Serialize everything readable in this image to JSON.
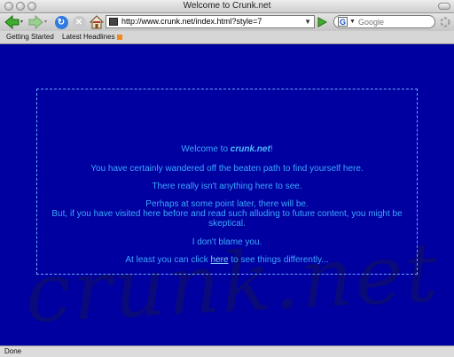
{
  "window": {
    "title": "Welcome to Crunk.net"
  },
  "toolbar": {
    "url": "http://www.crunk.net/index.html?style=7",
    "search_engine": "G",
    "search_placeholder": "Google",
    "icons": [
      "back-icon",
      "forward-icon",
      "reload-icon",
      "stop-icon",
      "home-icon",
      "go-icon",
      "throbber-icon"
    ]
  },
  "bookmarks": {
    "items": [
      {
        "label": "Getting Started"
      },
      {
        "label": "Latest Headlines"
      }
    ]
  },
  "page": {
    "welcome_prefix": "Welcome to ",
    "welcome_site": "crunk.net",
    "welcome_suffix": "!",
    "line1": "You have certainly wandered off the beaten path to find yourself here.",
    "line2": "There really isn't anything here to see.",
    "line3": "Perhaps at some point later, there will be.",
    "line4": "But, if you have visited here before and read such alluding to future content, you might be skeptical.",
    "line5": "I don't blame you.",
    "line6_prefix": "At least you can click ",
    "line6_link": "here",
    "line6_suffix": " to see things differently...",
    "watermark": "crunk.net"
  },
  "colors": {
    "background": "#0000a0",
    "text": "#3aa8ff",
    "border": "#6fa8ff"
  },
  "status": {
    "text": "Done"
  }
}
